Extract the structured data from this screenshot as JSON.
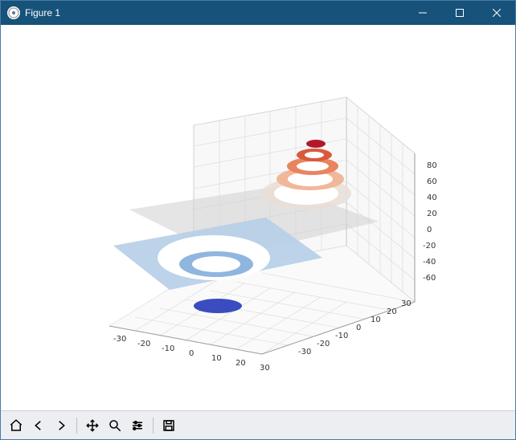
{
  "window": {
    "title": "Figure 1",
    "controls": {
      "minimize": "minimize",
      "maximize": "maximize",
      "close": "close"
    }
  },
  "toolbar": {
    "items": [
      "home",
      "back",
      "forward",
      "pan",
      "zoom",
      "configure",
      "save"
    ]
  },
  "chart_data": {
    "type": "contour3d",
    "description": "3D filled contour plot of a radial sine surface z = A * sin(sqrt(x^2 + y^2) * k), rendered with a coolwarm colormap and a translucent gray plane at z=0",
    "x_range": [
      -30,
      30
    ],
    "y_range": [
      -30,
      30
    ],
    "z_range": [
      -60,
      80
    ],
    "x_ticks": [
      -30,
      -20,
      -10,
      0,
      10,
      20,
      30
    ],
    "y_ticks": [
      -30,
      -20,
      -10,
      0,
      10,
      20,
      30
    ],
    "z_ticks": [
      -60,
      -40,
      -20,
      0,
      20,
      40,
      60,
      80
    ],
    "colormap": "coolwarm",
    "colors": {
      "low": "#3b4cc0",
      "mid_low": "#aec7e8",
      "mid": "#dddddd",
      "mid_high": "#f4a582",
      "high": "#b2182b"
    },
    "contour_levels": [
      -60,
      -40,
      -20,
      0,
      20,
      40,
      60,
      80
    ],
    "plane_z": 0,
    "title": "",
    "xlabel": "",
    "ylabel": "",
    "zlabel": ""
  }
}
